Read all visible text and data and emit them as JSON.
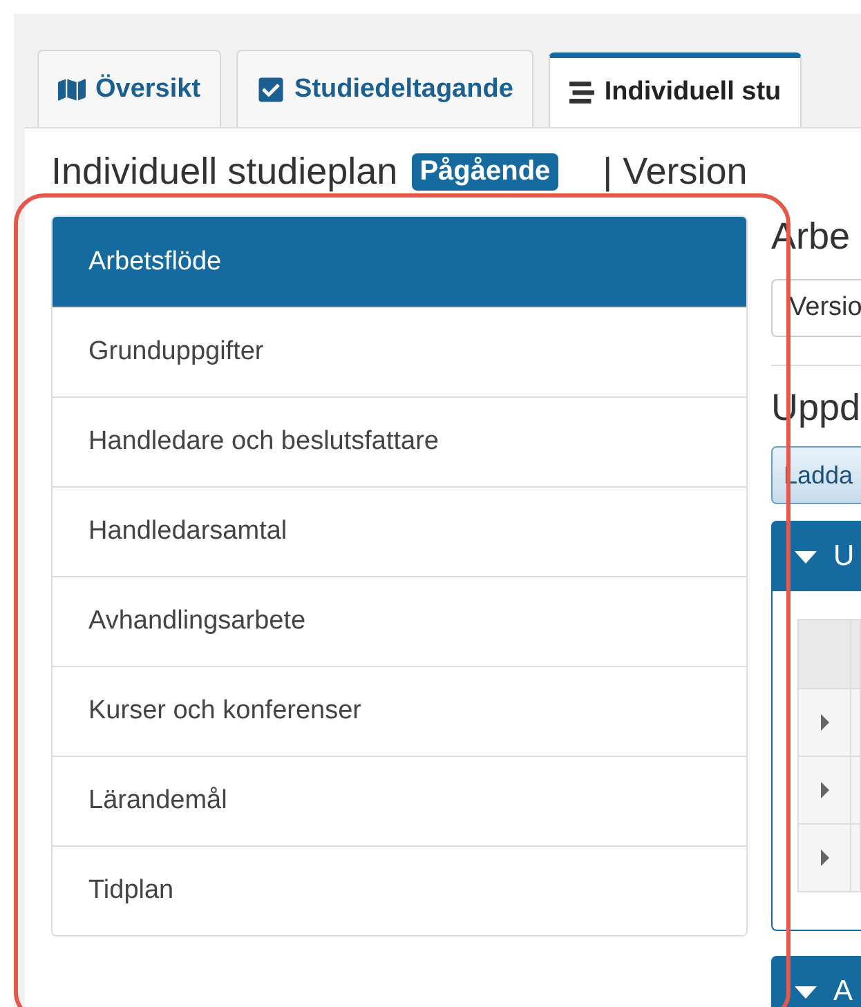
{
  "tabs": [
    {
      "label": "Översikt",
      "selected": false
    },
    {
      "label": "Studiedeltagande",
      "selected": false
    },
    {
      "label": "Individuell stu",
      "selected": true
    }
  ],
  "header": {
    "title": "Individuell studieplan",
    "status_badge": "Pågående",
    "version": "| Version"
  },
  "sidebar": {
    "items": [
      {
        "label": "Arbetsflöde",
        "selected": true
      },
      {
        "label": "Grunduppgifter",
        "selected": false
      },
      {
        "label": "Handledare och beslutsfattare",
        "selected": false
      },
      {
        "label": "Handledarsamtal",
        "selected": false
      },
      {
        "label": "Avhandlingsarbete",
        "selected": false
      },
      {
        "label": "Kurser och konferenser",
        "selected": false
      },
      {
        "label": "Lärandemål",
        "selected": false
      },
      {
        "label": "Tidplan",
        "selected": false
      }
    ]
  },
  "main": {
    "heading": "Arbe",
    "version_select": "Versio",
    "section_heading": "Uppd",
    "button": "Ladda",
    "panels": [
      {
        "title": "U",
        "expanded": true
      },
      {
        "title": "A",
        "expanded": true
      }
    ]
  }
}
